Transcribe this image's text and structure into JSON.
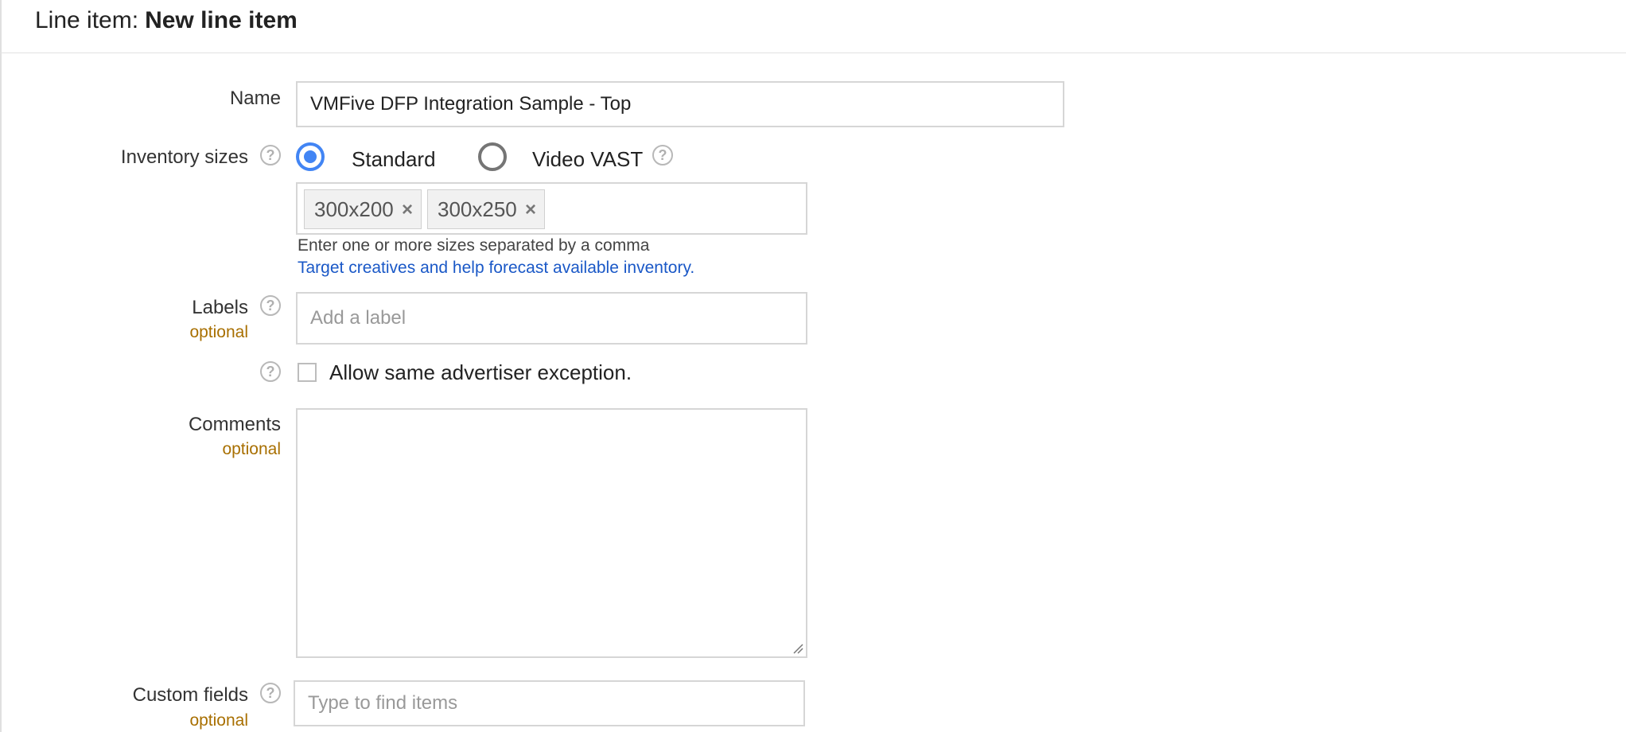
{
  "header": {
    "prefix": "Line item:",
    "name": "New line item"
  },
  "form": {
    "name": {
      "label": "Name",
      "value": "VMFive DFP Integration Sample - Top"
    },
    "inventory_sizes": {
      "label": "Inventory sizes",
      "options": {
        "standard": "Standard",
        "video": "Video VAST"
      },
      "selected": "Standard",
      "chips": [
        "300x200",
        "300x250"
      ],
      "hint": "Enter one or more sizes separated by a comma",
      "link": "Target creatives and help forecast available inventory."
    },
    "labels": {
      "label": "Labels",
      "optional": "optional",
      "placeholder": "Add a label"
    },
    "same_advertiser": {
      "label": "Allow same advertiser exception.",
      "checked": false
    },
    "comments": {
      "label": "Comments",
      "optional": "optional",
      "value": ""
    },
    "custom_fields": {
      "label": "Custom fields",
      "optional": "optional",
      "placeholder": "Type to find items"
    }
  },
  "icons": {
    "help": "help-circle-icon",
    "chip_remove": "close-icon",
    "resize": "resize-grip-icon",
    "help_glyph": "?",
    "remove_glyph": "×"
  },
  "colors": {
    "accent": "#4285f4",
    "optional": "#a86f00",
    "link": "#1a58c7"
  }
}
